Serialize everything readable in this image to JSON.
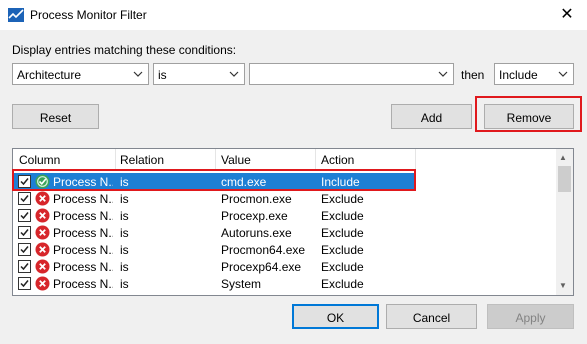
{
  "window": {
    "title": "Process Monitor Filter",
    "close_glyph": "✕"
  },
  "conditions": {
    "label": "Display entries matching these conditions:",
    "column_value": "Architecture",
    "relation_value": "is",
    "value_text": "",
    "then_label": "then",
    "action_value": "Include"
  },
  "buttons": {
    "reset": "Reset",
    "add": "Add",
    "remove": "Remove",
    "ok": "OK",
    "cancel": "Cancel",
    "apply": "Apply"
  },
  "list": {
    "headers": [
      "Column",
      "Relation",
      "Value",
      "Action"
    ],
    "rows": [
      {
        "column": "Process N...",
        "relation": "is",
        "value": "cmd.exe",
        "action": "Include",
        "selected": true,
        "icon": "include-icon"
      },
      {
        "column": "Process N...",
        "relation": "is",
        "value": "Procmon.exe",
        "action": "Exclude",
        "selected": false,
        "icon": "exclude-icon"
      },
      {
        "column": "Process N...",
        "relation": "is",
        "value": "Procexp.exe",
        "action": "Exclude",
        "selected": false,
        "icon": "exclude-icon"
      },
      {
        "column": "Process N...",
        "relation": "is",
        "value": "Autoruns.exe",
        "action": "Exclude",
        "selected": false,
        "icon": "exclude-icon"
      },
      {
        "column": "Process N...",
        "relation": "is",
        "value": "Procmon64.exe",
        "action": "Exclude",
        "selected": false,
        "icon": "exclude-icon"
      },
      {
        "column": "Process N...",
        "relation": "is",
        "value": "Procexp64.exe",
        "action": "Exclude",
        "selected": false,
        "icon": "exclude-icon"
      },
      {
        "column": "Process N...",
        "relation": "is",
        "value": "System",
        "action": "Exclude",
        "selected": false,
        "icon": "exclude-icon"
      }
    ]
  },
  "colors": {
    "highlight": "#e0191d",
    "selection": "#1e7fd4",
    "primary_border": "#0078d7"
  }
}
